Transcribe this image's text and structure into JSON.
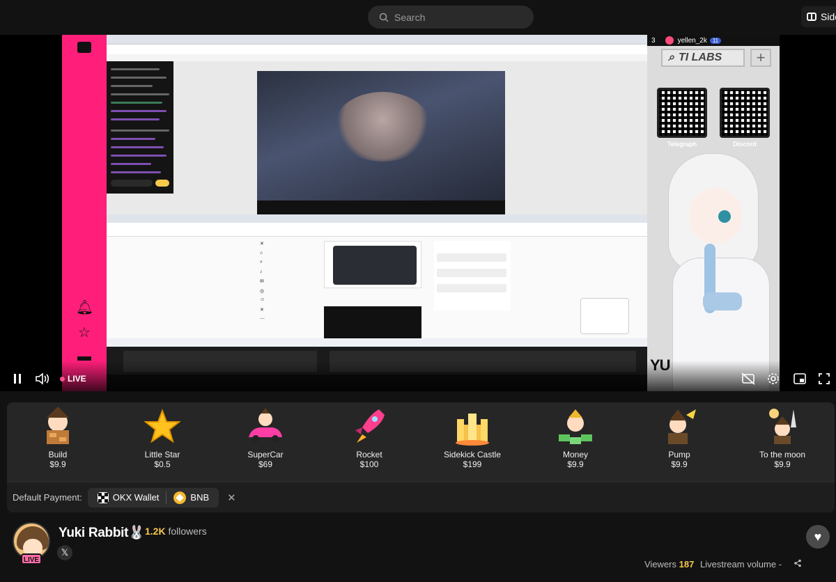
{
  "search": {
    "placeholder": "Search"
  },
  "sidebar_toggle": {
    "label": "Side"
  },
  "player": {
    "live_label": "LIVE",
    "overlay": {
      "viewer_count_small": "3",
      "overlay_user": "yellen_2k",
      "overlay_badge": "11",
      "brand_text": "TI LABS",
      "qr_left_label": "Telegraph",
      "qr_right_label": "Discord",
      "corner_text": "YU"
    }
  },
  "gifts": [
    {
      "name": "Build",
      "price": "$9.9",
      "icon": "build-gift-icon"
    },
    {
      "name": "Little Star",
      "price": "$0.5",
      "icon": "star-gift-icon"
    },
    {
      "name": "SuperCar",
      "price": "$69",
      "icon": "car-gift-icon"
    },
    {
      "name": "Rocket",
      "price": "$100",
      "icon": "rocket-gift-icon"
    },
    {
      "name": "Sidekick Castle",
      "price": "$199",
      "icon": "castle-gift-icon"
    },
    {
      "name": "Money",
      "price": "$9.9",
      "icon": "money-gift-icon"
    },
    {
      "name": "Pump",
      "price": "$9.9",
      "icon": "pump-gift-icon"
    },
    {
      "name": "To the moon",
      "price": "$9.9",
      "icon": "moon-gift-icon"
    }
  ],
  "payment": {
    "label": "Default Payment:",
    "wallet": "OKX Wallet",
    "token": "BNB"
  },
  "streamer": {
    "name": "Yuki Rabbit🐰",
    "followers_count": "1.2K",
    "followers_label": " followers",
    "live_badge": "LIVE",
    "viewers_label": "Viewers ",
    "viewers_count": "187",
    "volume_label": "Livestream volume -"
  },
  "colors": {
    "accent_yellow": "#f6c94c",
    "live_pink": "#ff4f8f",
    "stream_pink_bar": "#ff1f7a"
  }
}
